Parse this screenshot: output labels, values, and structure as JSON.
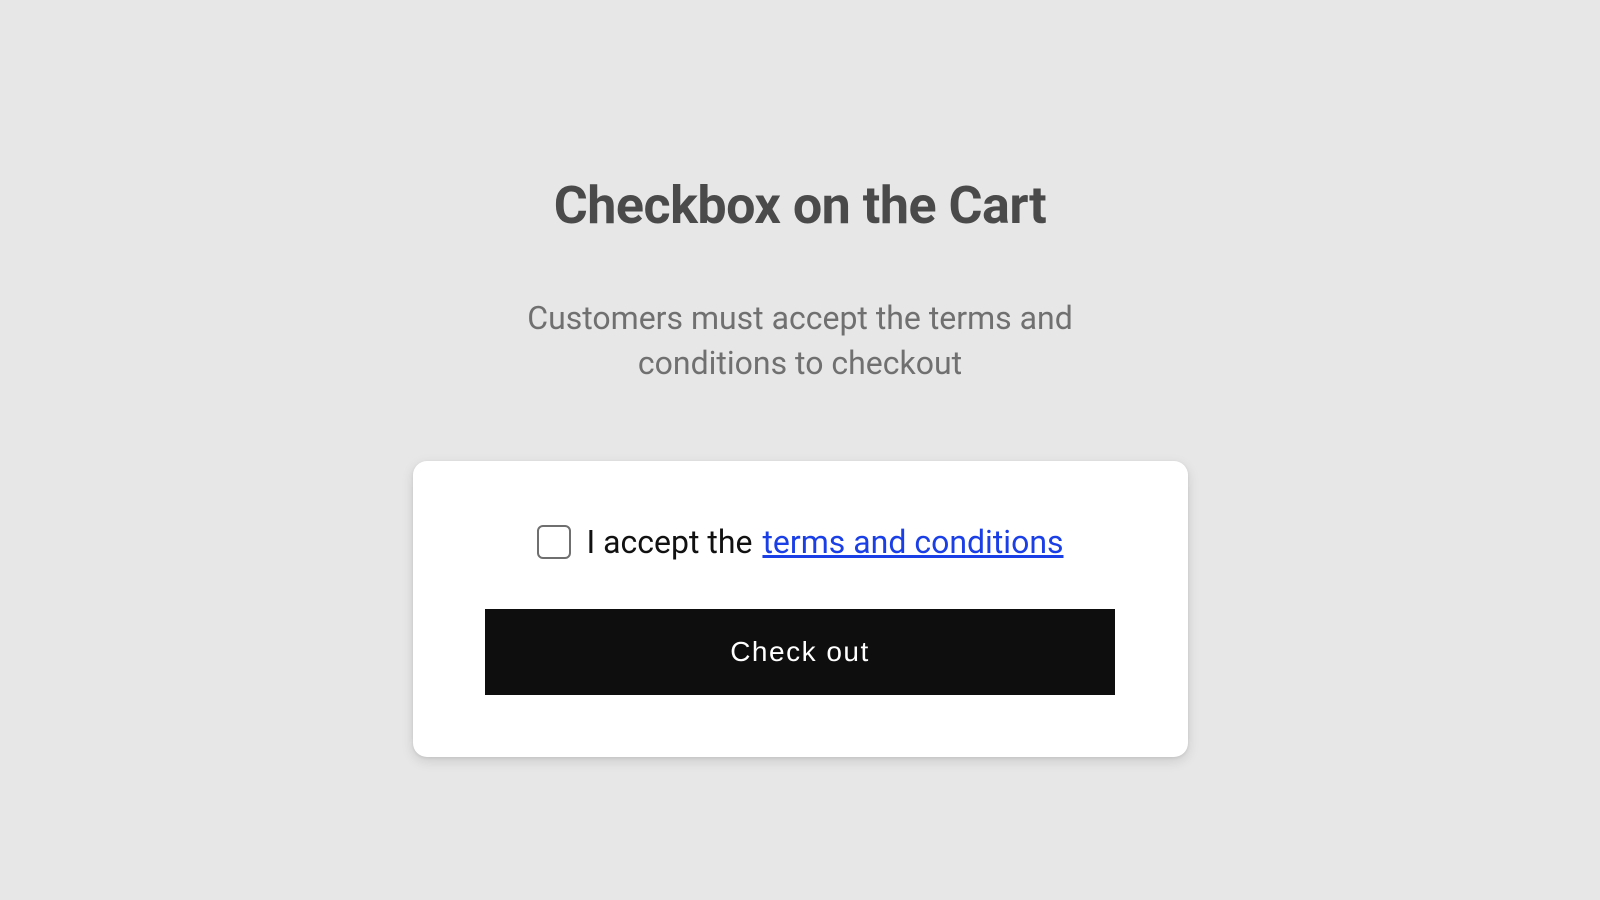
{
  "header": {
    "title": "Checkbox on the Cart",
    "subtitle": "Customers must accept the terms and conditions to checkout"
  },
  "card": {
    "checkbox_prefix": "I accept the",
    "terms_link_text": "terms and conditions",
    "checkout_button": "Check out"
  }
}
